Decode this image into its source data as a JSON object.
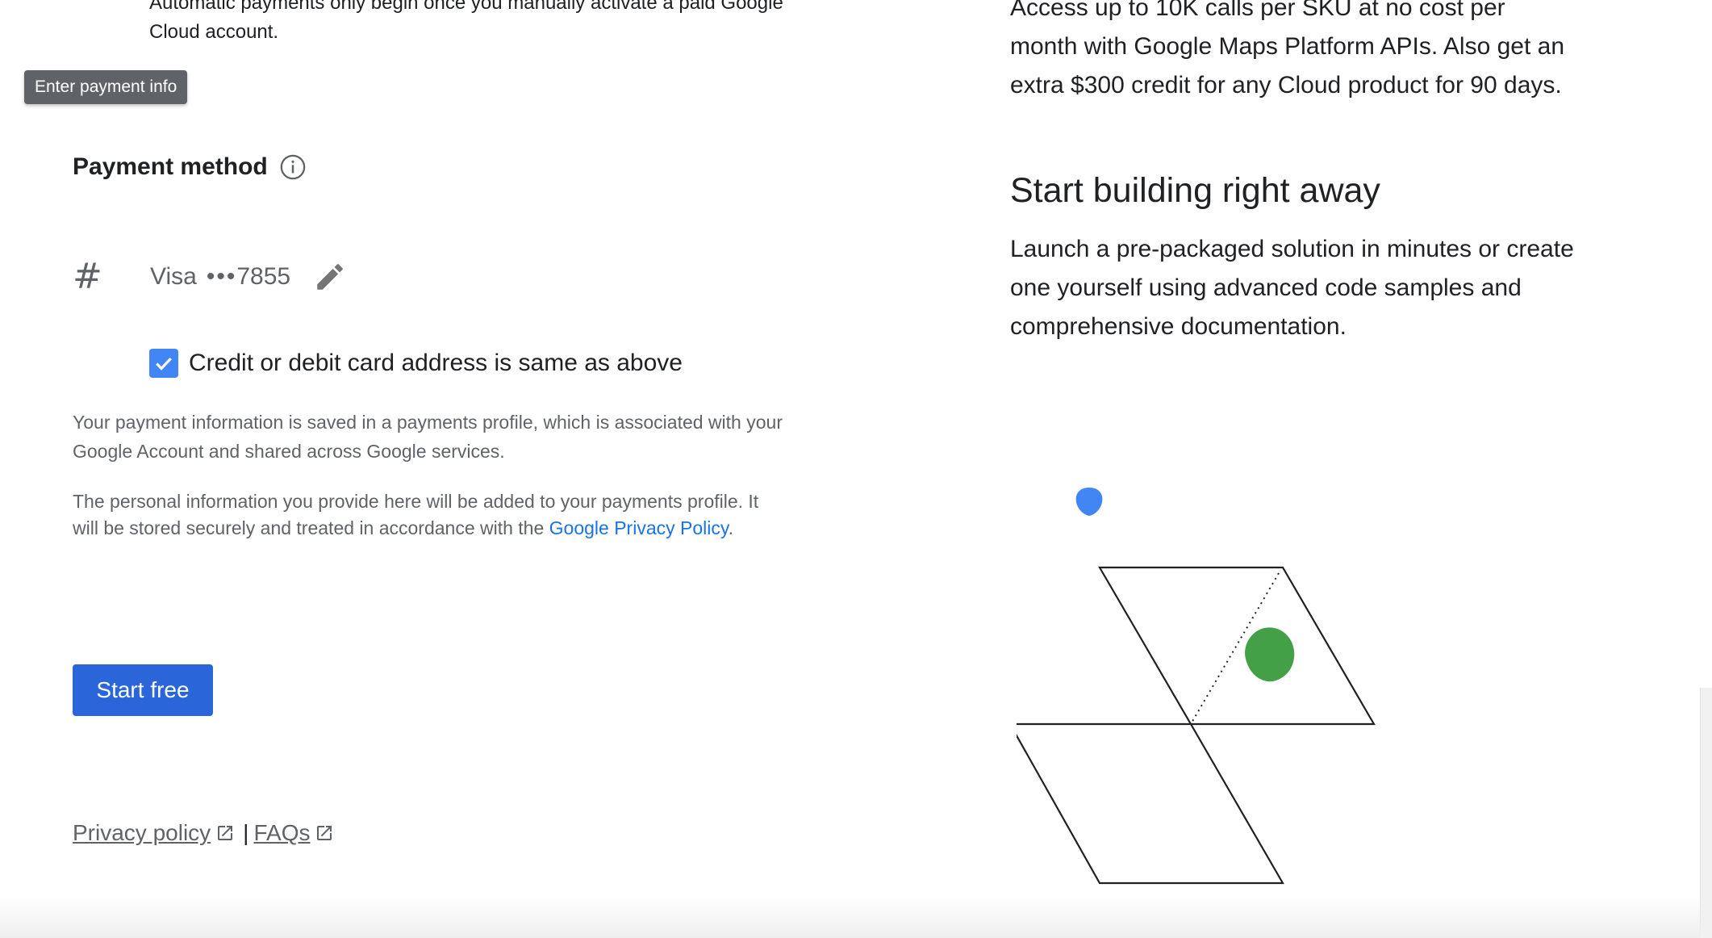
{
  "left": {
    "auto_note": "Automatic payments only begin once you manually activate a paid Google Cloud account.",
    "tooltip": "Enter payment info",
    "payment_method": {
      "title": "Payment method",
      "card_brand": "Visa",
      "card_dots": "•••",
      "card_last4": "7855"
    },
    "checkbox": {
      "label": "Credit or debit card address is same as above",
      "checked": true
    },
    "info_para_1": "Your payment information is saved in a payments profile, which is associated with your Google Account and shared across Google services.",
    "info_para_2_prefix": "The personal information you provide here will be added to your payments profile. It will be stored securely and treated in accordance with the ",
    "info_para_2_link": "Google Privacy Policy",
    "info_para_2_suffix": ".",
    "start_button": "Start free",
    "footer": {
      "privacy_label": "Privacy policy",
      "separator": "|",
      "faqs_label": "FAQs"
    }
  },
  "right": {
    "promo_text": "Access up to 10K calls per SKU at no cost per month with Google Maps Platform APIs. Also get an extra $300 credit for any Cloud product for 90 days.",
    "heading": "Start building right away",
    "body": "Launch a pre-packaged solution in minutes or create one yourself using advanced code samples and comprehensive documentation."
  },
  "colors": {
    "accent_blue": "#2a66d9",
    "link_blue": "#1a73e8",
    "checkbox_blue": "#4285f4",
    "illustration_blue": "#4285f4",
    "illustration_green": "#43a047"
  },
  "icons": [
    "info-icon",
    "hash-icon",
    "pencil-icon",
    "checkmark-icon",
    "external-link-icon"
  ]
}
